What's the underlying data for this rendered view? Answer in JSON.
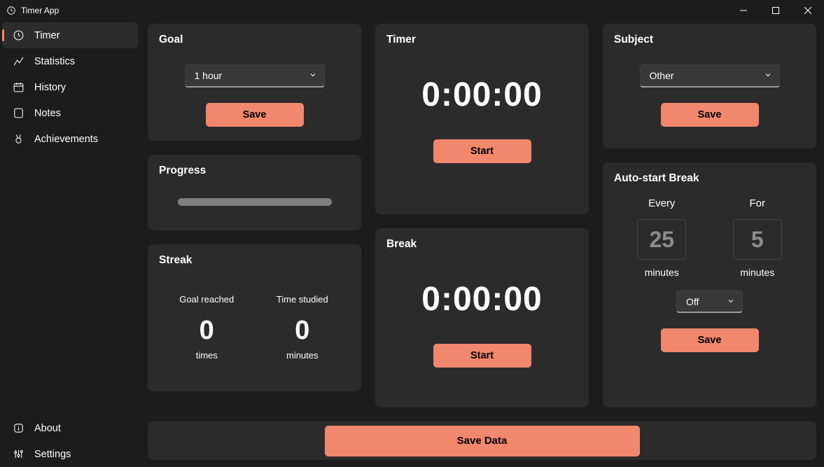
{
  "window": {
    "title": "Timer App"
  },
  "sidebar": {
    "items": [
      {
        "label": "Timer",
        "selected": true
      },
      {
        "label": "Statistics",
        "selected": false
      },
      {
        "label": "History",
        "selected": false
      },
      {
        "label": "Notes",
        "selected": false
      },
      {
        "label": "Achievements",
        "selected": false
      }
    ],
    "footer": [
      {
        "label": "About"
      },
      {
        "label": "Settings"
      }
    ]
  },
  "goal": {
    "title": "Goal",
    "value": "1 hour",
    "save": "Save"
  },
  "progress": {
    "title": "Progress",
    "percent": 0
  },
  "streak": {
    "title": "Streak",
    "col1_head": "Goal reached",
    "col1_val": "0",
    "col1_unit": "times",
    "col2_head": "Time studied",
    "col2_val": "0",
    "col2_unit": "minutes"
  },
  "timer": {
    "title": "Timer",
    "value": "0:00:00",
    "start": "Start"
  },
  "breakc": {
    "title": "Break",
    "value": "0:00:00",
    "start": "Start"
  },
  "subject": {
    "title": "Subject",
    "value": "Other",
    "save": "Save"
  },
  "auto": {
    "title": "Auto-start Break",
    "every_label": "Every",
    "every_val": "25",
    "every_unit": "minutes",
    "for_label": "For",
    "for_val": "5",
    "for_unit": "minutes",
    "mode": "Off",
    "save": "Save"
  },
  "bottom": {
    "save_data": "Save Data"
  }
}
